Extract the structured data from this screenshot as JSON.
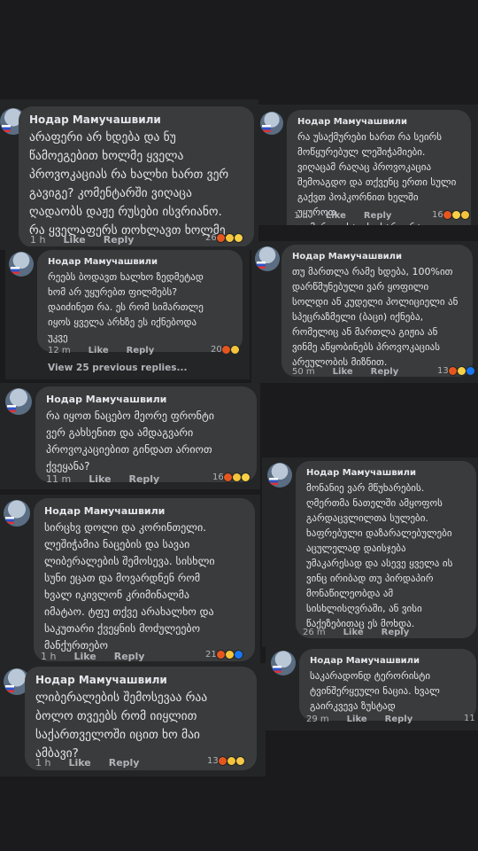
{
  "author": "Нодар Мамучашвили",
  "actions": {
    "like": "Like",
    "reply": "Reply"
  },
  "comments": [
    {
      "text": "არაფერი არ ხდება და ნუ\nწამოეგებით ხოლმე ყველა\nპროვოკაციას რა ხალხი ხართ ვერ\nგავიგე? კომენტარში ვიღაცა\nღადაობს დაჟე რუსები ისვრიანო.\nრა ყველაფერს თოხლავთ ხოლმე",
      "time": "1 h",
      "reaction_count": "26",
      "reactions": [
        "angry",
        "sad",
        "laugh"
      ]
    },
    {
      "text": "რა უსაქმურები ხართ რა სეირს\nმოწყურებულ ლეშიჭამიები.\nვიღაცამ რაღაც პროვოკაცია\nშემოაგდო და თქვენც ერთი სული\nგაქვთ პოპკორნით ხელში უყუროთ.\nუღმერთო ხალხი ხართ რა",
      "time": "1 h",
      "reaction_count": "16",
      "reactions": [
        "angry",
        "laugh",
        "sad"
      ]
    },
    {
      "text": "რეებს ბოდავთ ხალხო ზედმეტად\nხომ არ უყურებთ ფილმებს?\nდაიძინეთ რა. ეს რომ სიმართლე\nიყოს ყველა არხზე ეს იქნებოდა\nუკვე",
      "time": "12 m",
      "reaction_count": "20",
      "reactions": [
        "angry",
        "sad"
      ]
    },
    {
      "text": "თუ მართლა რამე ხდება, 100%ით\nდარწმუნებული ვარ ყოფილი\nსოლდი ან კუდელი პოლიციელი ან\nსპეცრაზმელი (ბაცი) იქნება,\nრომელიც ან მართლა გიჟია ან\nვინმე აწყობინებს პროვოკაციას\nარეულობის მიზნით.",
      "time": "50 m",
      "reaction_count": "13",
      "reactions": [
        "angry",
        "laugh",
        "like"
      ]
    },
    {
      "text": "რა იყოთ ნაცებო მეორე ფრონტი\nვერ გახსენით და ამდაგვარი\nპროვოკაციებით გინდათ არიოთ\nქვეყანა?",
      "time": "11 m",
      "reaction_count": "16",
      "reactions": [
        "angry",
        "sad",
        "laugh"
      ]
    },
    {
      "text": "მონანიე ვარ მწუხარების.\nღმერთმა ნათელში ამყოფოს\nგარდაცვლილთა სულები.\nხაფრებული დაზარალებულები\nაცულელად დაისჯება\nუმაკარესად და ასევე ყველა ის\nვინც ირიბად თუ პირდაპირ\nმონაწილეობდა ამ\nსისხლისღვრაში, ან ვისი\nწაქეზებითაც ეს მოხდა.",
      "time": "26 m",
      "reaction_count": "",
      "reactions": []
    },
    {
      "text": "სირცხვ დოლი და კორინთელი.\nლეშიჭამია ნაცების და სავაი\nლიბერალების შემოსევა. სისხლი\nსუნი ეცათ და მოვარდნენ რომ\nხვალ იკივლონ კრიმინალმა\nიმატაო. ტფუ თქვე არახალხო და\nსაკუთარი ქვეყნის მოძულეებო\nმანქურთებო",
      "time": "1 h",
      "reaction_count": "21",
      "reactions": [
        "angry",
        "sad",
        "like"
      ]
    },
    {
      "text": "საკარადონდ ტერორისტი\nტვინშერყეული ნაცია. ხვალ\nგაირკვევა ზუსტად",
      "time": "29 m",
      "reaction_count": "11",
      "reactions": []
    },
    {
      "text": "ლიბერალების შემოსევაა რაა\nბოლო თვეებს რომ იიყლით\nსაქართველოში იცით ხო მაი\nამბავი?",
      "time": "1 h",
      "reaction_count": "13",
      "reactions": [
        "angry",
        "sad",
        "wow"
      ]
    }
  ],
  "view_more": "View 25 previous replies..."
}
